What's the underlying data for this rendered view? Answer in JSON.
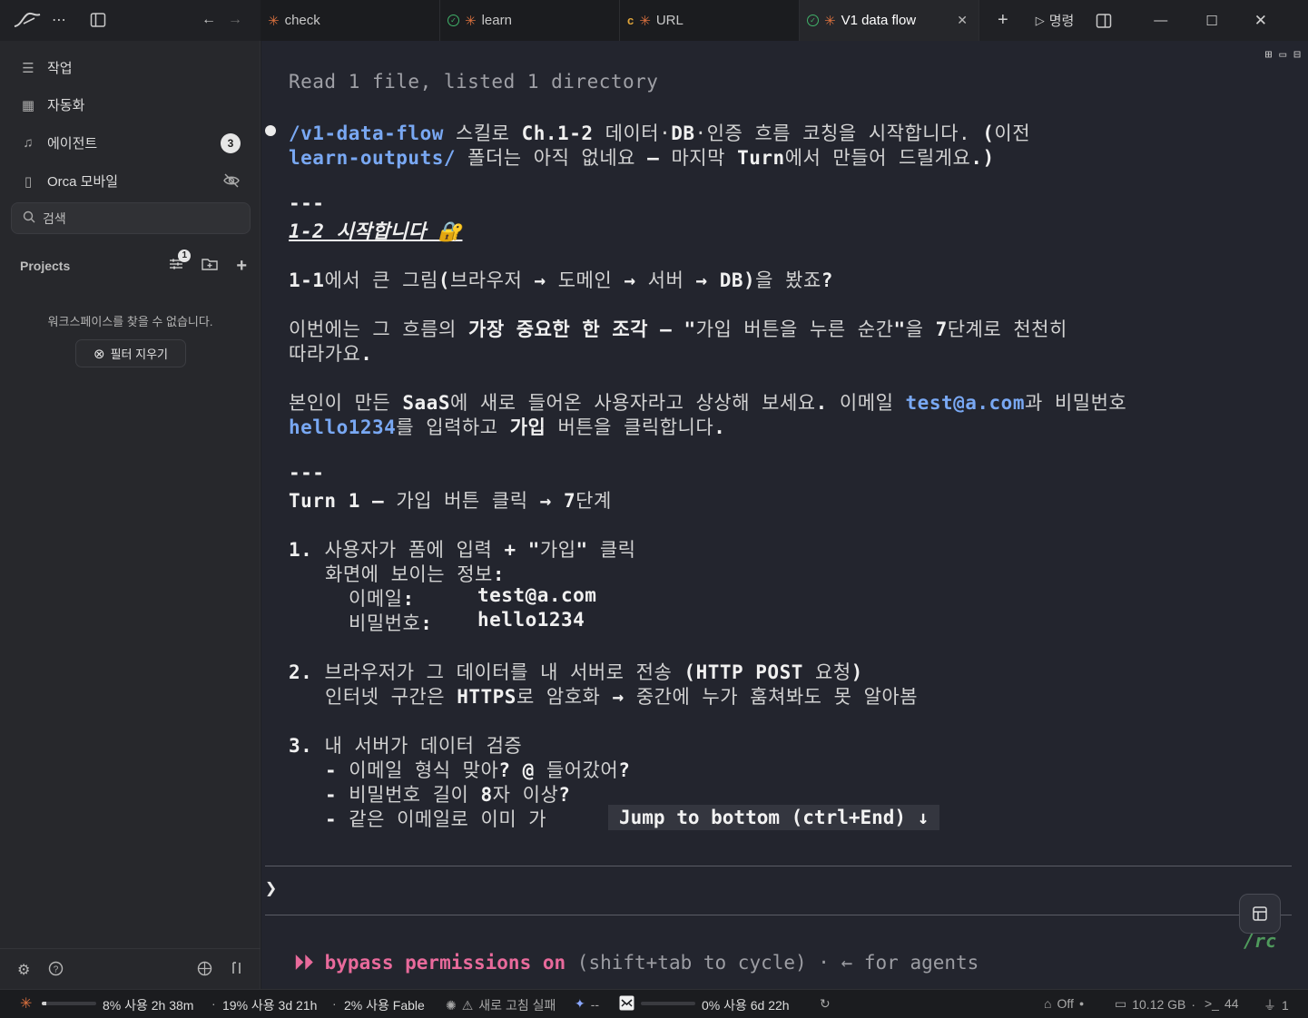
{
  "titlebar": {
    "tabs": [
      {
        "label": "check",
        "status": "none"
      },
      {
        "label": "learn",
        "status": "done"
      },
      {
        "label": "URL",
        "status": "c"
      },
      {
        "label": "V1 data flow",
        "status": "done"
      }
    ],
    "command_label": "명령"
  },
  "sidebar": {
    "items": [
      {
        "label": "작업",
        "icon": "list-icon"
      },
      {
        "label": "자동화",
        "icon": "calendar-clock-icon"
      },
      {
        "label": "에이전트",
        "icon": "bell-icon",
        "badge": "3"
      },
      {
        "label": "Orca 모바일",
        "icon": "phone-icon"
      }
    ],
    "search_placeholder": "검색",
    "projects_label": "Projects",
    "filter_badge": "1",
    "empty_message": "워크스페이스를 찾을 수 없습니다.",
    "clear_filter_label": "필터 지우기"
  },
  "terminal": {
    "read_line": "Read 1 file, listed 1 directory",
    "p1": {
      "cmd": "/v1-data-flow",
      "t1": " 스킬로 ",
      "ch": "Ch.1-2",
      "t2": " 데이터·",
      "db": "DB",
      "t3": "·인증 흐름 코칭을 시작합니다. ",
      "paren": "(",
      "t4": "이전",
      "folder": "learn-outputs/",
      "t5": " 폴더는 아직 없네요 ",
      "dash": "—",
      "t6": " 마지막 ",
      "turn": "Turn",
      "t7": "에서 만들어 드릴게요",
      "end": ".)"
    },
    "hr1": "---",
    "h1": "1-2 시작합니다 🔐",
    "s1": {
      "a": "1-1",
      "b": "에서 큰 그림",
      "c": "(",
      "d": "브라우저 ",
      "e": "→",
      "f": " 도메인 ",
      "g": "→",
      "h": " 서버 ",
      "i": "→",
      "j": " DB)",
      "k": "을 봤죠",
      "l": "?"
    },
    "s2": {
      "a": "이번에는 그 흐름의 ",
      "b": "가장 중요한 한 조각",
      "c": " ",
      "d": "—",
      "e": " ",
      "f": "\"",
      "g": "가입 버튼을 누른 순간",
      "h": "\"",
      "i": "을 ",
      "j": "7",
      "k": "단계로 천천히",
      "l": "따라가요",
      "m": "."
    },
    "s3": {
      "a": "본인이 만든 ",
      "b": "SaaS",
      "c": "에 새로 들어온 사용자라고 상상해 보세요",
      "d": ".",
      "e": " 이메일 ",
      "email": "test@a.com",
      "f": "과 비밀번호",
      "pw": "hello1234",
      "g": "를 입력하고 ",
      "h": "가입",
      "i": " 버튼을 클릭합니다",
      "j": "."
    },
    "hr2": "---",
    "h2": {
      "a": "Turn 1 ",
      "b": "—",
      "c": " 가입 버튼 클릭 ",
      "d": "→",
      "e": " 7",
      "f": "단계"
    },
    "step1": {
      "num": "1.",
      "a": " 사용자가 폼에 입력 ",
      "b": "+",
      "c": " \"",
      "d": "가입",
      "e": "\"",
      "f": " 클릭",
      "screen": "화면에 보이는 정보",
      "colon": ":",
      "email_label": "이메일",
      "email_colon": ":",
      "email": "test@a.com",
      "pw_label": "비밀번호",
      "pw_colon": ":",
      "pw": "hello1234"
    },
    "step2": {
      "num": "2.",
      "a": " 브라우저가 그 데이터를 내 서버로 전송 ",
      "b": "(HTTP POST",
      "c": " 요청",
      "d": ")",
      "e": "인터넷 구간은 ",
      "f": "HTTPS",
      "g": "로 암호화 ",
      "h": "→",
      "i": " 중간에 누가 훔쳐봐도 못 알아봄"
    },
    "step3": {
      "num": "3.",
      "a": " 내 서버가 데이터 검증",
      "dash": "-",
      "b1": " 이메일 형식 맞아",
      "b1q": "? @",
      "b1c": " 들어갔어",
      "b1d": "?",
      "b2": " 비밀번호 길이 ",
      "b2n": "8",
      "b2c": "자 이상",
      "b2d": "?",
      "b3": " 같은 이메일로 이미 가"
    },
    "jump": "Jump to bottom (ctrl+End) ↓",
    "prompt": "❯",
    "rc": "/rc",
    "bypass": {
      "arrows": "⏵⏵",
      "a": " bypass permissions on",
      "b": " (shift+tab to cycle) · ← for agents"
    }
  },
  "statusbar": {
    "usage1": "8% 사용 2h 38m",
    "usage1_fill": 0.08,
    "sep1": "·",
    "usage2": "19% 사용 3d 21h",
    "sep2": "·",
    "usage3": "2% 사용 Fable",
    "refresh_fail": "새로 고침 실패",
    "dashes": "--",
    "usage4": "0% 사용 6d 22h",
    "usage4_fill": 0.0,
    "off": "Off",
    "memory": "10.12 GB",
    "terminals": "44",
    "ports": "1"
  },
  "colors": {
    "accent_blue": "#79a8f3",
    "pink": "#e86a9b",
    "green_rc": "#4f9a5c",
    "star_orange": "#d9703e"
  }
}
